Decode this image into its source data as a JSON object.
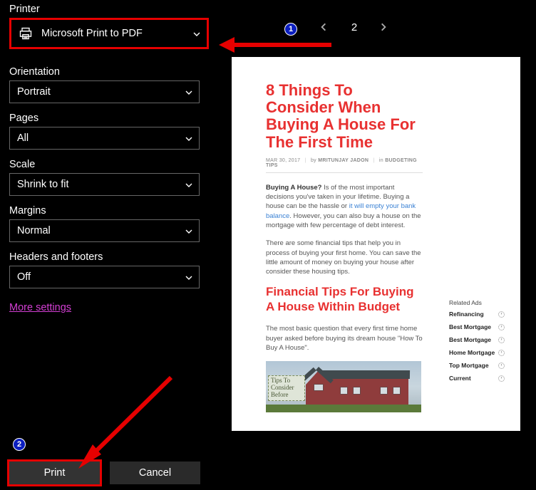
{
  "panel": {
    "printer": {
      "label": "Printer",
      "value": "Microsoft Print to PDF"
    },
    "orientation": {
      "label": "Orientation",
      "value": "Portrait"
    },
    "pages": {
      "label": "Pages",
      "value": "All"
    },
    "scale": {
      "label": "Scale",
      "value": "Shrink to fit"
    },
    "margins": {
      "label": "Margins",
      "value": "Normal"
    },
    "headers": {
      "label": "Headers and footers",
      "value": "Off"
    },
    "more_link": "More settings"
  },
  "buttons": {
    "print": "Print",
    "cancel": "Cancel"
  },
  "nav": {
    "page_number": "2"
  },
  "preview": {
    "title": "8 Things To Consider When Buying A House For The First Time",
    "meta": {
      "date": "MAR 30, 2017",
      "author_prefix": "by",
      "author": "MRITUNJAY JADON",
      "cat_prefix": "in",
      "category": "BUDGETING TIPS"
    },
    "para1a": "Buying A House?",
    "para1b": " Is of the most important decisions you've taken in your lifetime. Buying a house can be the hassle or ",
    "para1_link": "it will empty your bank balance",
    "para1c": ". However, you can also buy a house on the mortgage with few percentage of debt interest.",
    "para2": "There are some financial tips that help you in process of buying your first home. You can save the little amount of money on buying your house after consider these housing tips.",
    "subhead": "Financial Tips For Buying A House Within Budget",
    "para3": "The most basic question that every first time home buyer asked before buying its dream house \"How To Buy A House\".",
    "img_caption": "Tips To Consider Before",
    "ads": {
      "title": "Related Ads",
      "items": [
        "Refinancing",
        "Best Mortgage",
        "Best Mortgage",
        "Home Mortgage",
        "Top Mortgage",
        "Current"
      ]
    }
  },
  "annotations": {
    "badge1": "1",
    "badge2": "2"
  }
}
